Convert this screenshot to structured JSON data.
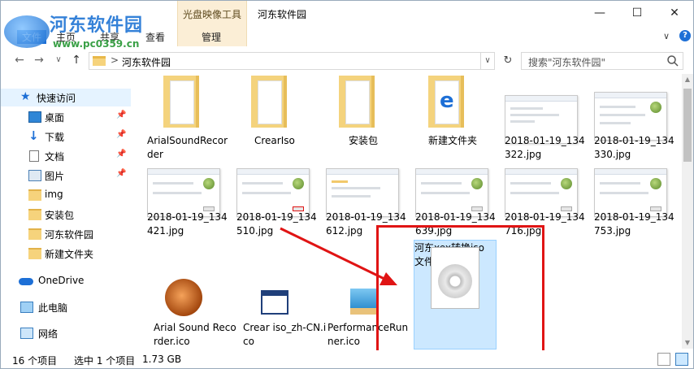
{
  "window": {
    "title": "河东软件园",
    "contextual_tab_title": "光盘映像工具",
    "minimize_label": "—",
    "maximize_label": "☐",
    "close_label": "✕"
  },
  "watermark": {
    "site_name": "河东软件园",
    "url": "www.pc0359.cn"
  },
  "ribbon": {
    "tabs": [
      "文件",
      "主页",
      "共享",
      "查看",
      "管理"
    ],
    "collapse_glyph": "∨",
    "help_glyph": "?"
  },
  "address": {
    "back_glyph": "←",
    "forward_glyph": "→",
    "recent_glyph": "∨",
    "up_glyph": "↑",
    "separator": ">",
    "path": "河东软件园",
    "dropdown_glyph": "∨",
    "refresh_glyph": "↻"
  },
  "search": {
    "placeholder": "搜索\"河东软件园\""
  },
  "nav": {
    "quick_access": "快速访问",
    "items": [
      {
        "label": "桌面",
        "icon": "desktop-icon",
        "pinned": true
      },
      {
        "label": "下载",
        "icon": "download-icon",
        "pinned": true
      },
      {
        "label": "文档",
        "icon": "documents-icon",
        "pinned": true
      },
      {
        "label": "图片",
        "icon": "pictures-icon",
        "pinned": true
      },
      {
        "label": "img",
        "icon": "folder-icon",
        "pinned": false
      },
      {
        "label": "安装包",
        "icon": "folder-icon",
        "pinned": false
      },
      {
        "label": "河东软件园",
        "icon": "folder-icon",
        "pinned": false
      },
      {
        "label": "新建文件夹",
        "icon": "folder-icon",
        "pinned": false
      }
    ],
    "onedrive": "OneDrive",
    "this_pc": "此电脑",
    "network": "网络",
    "pin_glyph": "📌"
  },
  "files": {
    "row1": [
      "ArialSoundRecorder",
      "CrearIso",
      "安装包",
      "新建文件夹",
      "2018-01-19_134322.jpg",
      "2018-01-19_134330.jpg"
    ],
    "row2": [
      "2018-01-19_134421.jpg",
      "2018-01-19_134510.jpg",
      "2018-01-19_134612.jpg",
      "2018-01-19_134639.jpg",
      "2018-01-19_134716.jpg",
      "2018-01-19_134753.jpg"
    ],
    "row3": [
      "Arial Sound Recorder.ico",
      "Crear iso_zh-CN.ico",
      "PerformanceRunner.ico",
      "河东xex转换iso文件.iso"
    ]
  },
  "status": {
    "item_count": "16 个项目",
    "selection": "选中 1 个项目",
    "size": "1.73 GB"
  },
  "colors": {
    "selection_bg": "#cce8ff",
    "annotation_red": "#e01414",
    "contextual_tab": "#fbeed6",
    "accent": "#1d6fd6"
  }
}
